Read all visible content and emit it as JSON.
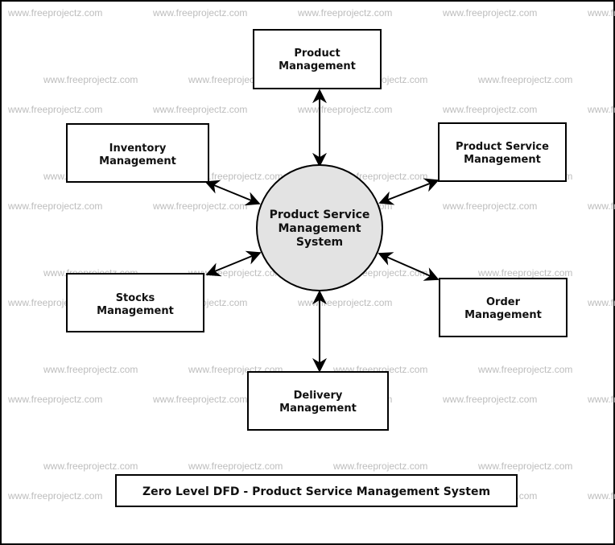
{
  "diagram": {
    "title": "Zero Level DFD - Product Service Management System",
    "watermark_text": "www.freeprojectz.com",
    "colors": {
      "process_fill": "#e3e3e3",
      "stroke": "#000000",
      "watermark": "#bdbdbd"
    },
    "center_process": {
      "lines": [
        "Product Service",
        "Management",
        "System"
      ]
    },
    "entities": [
      {
        "id": "product",
        "lines": [
          "Product",
          "Management"
        ]
      },
      {
        "id": "inventory",
        "lines": [
          "Inventory",
          "Management"
        ]
      },
      {
        "id": "product-service",
        "lines": [
          "Product Service",
          "Management"
        ]
      },
      {
        "id": "stocks",
        "lines": [
          "Stocks",
          "Management"
        ]
      },
      {
        "id": "order",
        "lines": [
          "Order",
          "Management"
        ]
      },
      {
        "id": "delivery",
        "lines": [
          "Delivery",
          "Management"
        ]
      }
    ],
    "flows": [
      {
        "from": "product",
        "to": "center",
        "direction": "bidirectional"
      },
      {
        "from": "inventory",
        "to": "center",
        "direction": "bidirectional"
      },
      {
        "from": "product-service",
        "to": "center",
        "direction": "bidirectional"
      },
      {
        "from": "stocks",
        "to": "center",
        "direction": "bidirectional"
      },
      {
        "from": "order",
        "to": "center",
        "direction": "bidirectional"
      },
      {
        "from": "delivery",
        "to": "center",
        "direction": "bidirectional"
      }
    ]
  }
}
